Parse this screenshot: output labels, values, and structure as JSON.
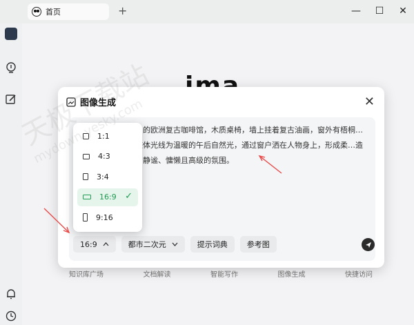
{
  "window": {
    "tab_label": "首页",
    "new_tab_symbol": "+",
    "minimize_symbol": "—",
    "maximize_symbol": "☐",
    "close_symbol": "✕"
  },
  "brand": {
    "logo_text": "ima"
  },
  "dialog": {
    "title": "图像生成",
    "close_symbol": "✕",
    "prompt_text": "…的欧洲复古咖啡馆，木质桌椅，墙上挂着复古油画，窗外有梧桐…整体光线为温暖的午后自然光，通过窗户洒在人物身上，形成柔…造出静谧、慵懒且高级的氛围。",
    "toolbar": {
      "ratio_selected": "16:9",
      "style_selected": "都市二次元",
      "prompt_dict_label": "提示词典",
      "reference_label": "参考图"
    }
  },
  "ratio_options": [
    {
      "label": "1:1",
      "selected": false
    },
    {
      "label": "4:3",
      "selected": false
    },
    {
      "label": "3:4",
      "selected": false
    },
    {
      "label": "16:9",
      "selected": true
    },
    {
      "label": "9:16",
      "selected": false
    }
  ],
  "bottom_nav": [
    "知识库广场",
    "文档解读",
    "智能写作",
    "图像生成",
    "快捷访问"
  ],
  "watermark": {
    "line1": "天极下载站",
    "line2": "mydown.yesky.com"
  },
  "colors": {
    "accent_green": "#1f9a52",
    "dialog_bg": "#ffffff",
    "annotation_red": "#e84a4a"
  }
}
